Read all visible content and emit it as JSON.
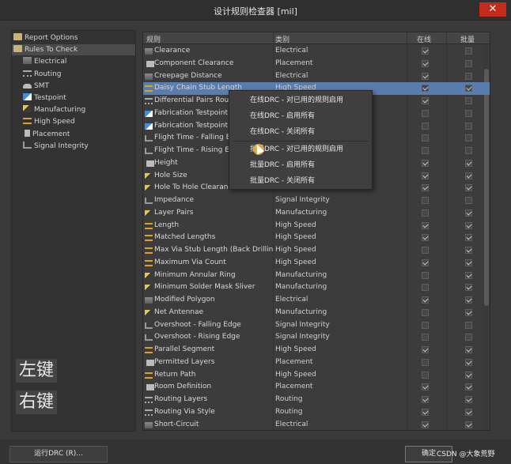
{
  "window": {
    "title": "设计规则检查器 [mil]",
    "close": "✕"
  },
  "tree": [
    {
      "label": "Report Options",
      "level": 0,
      "icon": "folder-icon",
      "selected": false
    },
    {
      "label": "Rules To Check",
      "level": 0,
      "icon": "folder-icon",
      "selected": true
    },
    {
      "label": "Electrical",
      "level": 1,
      "icon": "electrical-icon",
      "selected": false
    },
    {
      "label": "Routing",
      "level": 1,
      "icon": "routing-icon",
      "selected": false
    },
    {
      "label": "SMT",
      "level": 1,
      "icon": "smt-icon",
      "selected": false
    },
    {
      "label": "Testpoint",
      "level": 1,
      "icon": "testpoint-icon",
      "selected": false
    },
    {
      "label": "Manufacturing",
      "level": 1,
      "icon": "manufacturing-icon",
      "selected": false
    },
    {
      "label": "High Speed",
      "level": 1,
      "icon": "high-speed-icon",
      "selected": false
    },
    {
      "label": "Placement",
      "level": 1,
      "icon": "placement-icon",
      "selected": false
    },
    {
      "label": "Signal Integrity",
      "level": 1,
      "icon": "signal-integrity-icon",
      "selected": false
    }
  ],
  "hints": {
    "left": "左键",
    "right": "右键"
  },
  "table": {
    "headers": {
      "rule": "规则",
      "category": "类别",
      "online": "在线",
      "batch": "批量"
    },
    "rows": [
      {
        "rule": "Clearance",
        "category": "Electrical",
        "online": true,
        "batch": false,
        "icon": "electrical"
      },
      {
        "rule": "Component Clearance",
        "category": "Placement",
        "online": true,
        "batch": false,
        "icon": "placement"
      },
      {
        "rule": "Creepage Distance",
        "category": "Electrical",
        "online": true,
        "batch": false,
        "icon": "electrical"
      },
      {
        "rule": "Daisy Chain Stub Length",
        "category": "High Speed",
        "online": true,
        "batch": true,
        "icon": "speed"
      },
      {
        "rule": "Differential Pairs Routing",
        "category": "",
        "online": true,
        "batch": false,
        "icon": "routing"
      },
      {
        "rule": "Fabrication Testpoint S",
        "category": "",
        "online": false,
        "batch": false,
        "icon": "test"
      },
      {
        "rule": "Fabrication Testpoint U",
        "category": "",
        "online": false,
        "batch": false,
        "icon": "test"
      },
      {
        "rule": "Flight Time - Falling Ed",
        "category": "",
        "online": false,
        "batch": false,
        "icon": "signal"
      },
      {
        "rule": "Flight Time - Rising Edg",
        "category": "",
        "online": false,
        "batch": false,
        "icon": "signal"
      },
      {
        "rule": "Height",
        "category": "",
        "online": true,
        "batch": true,
        "icon": "placement"
      },
      {
        "rule": "Hole Size",
        "category": "",
        "online": true,
        "batch": true,
        "icon": "manu"
      },
      {
        "rule": "Hole To Hole Clearance",
        "category": "",
        "online": true,
        "batch": true,
        "icon": "manu"
      },
      {
        "rule": "Impedance",
        "category": "Signal Integrity",
        "online": false,
        "batch": false,
        "icon": "signal"
      },
      {
        "rule": "Layer Pairs",
        "category": "Manufacturing",
        "online": false,
        "batch": true,
        "icon": "manu"
      },
      {
        "rule": "Length",
        "category": "High Speed",
        "online": true,
        "batch": true,
        "icon": "speed"
      },
      {
        "rule": "Matched Lengths",
        "category": "High Speed",
        "online": true,
        "batch": true,
        "icon": "speed"
      },
      {
        "rule": "Max Via Stub Length (Back Drilling)",
        "category": "High Speed",
        "online": false,
        "batch": true,
        "icon": "speed"
      },
      {
        "rule": "Maximum Via Count",
        "category": "High Speed",
        "online": true,
        "batch": true,
        "icon": "speed"
      },
      {
        "rule": "Minimum Annular Ring",
        "category": "Manufacturing",
        "online": false,
        "batch": true,
        "icon": "manu"
      },
      {
        "rule": "Minimum Solder Mask Sliver",
        "category": "Manufacturing",
        "online": false,
        "batch": true,
        "icon": "manu"
      },
      {
        "rule": "Modified Polygon",
        "category": "Electrical",
        "online": true,
        "batch": true,
        "icon": "electrical"
      },
      {
        "rule": "Net Antennae",
        "category": "Manufacturing",
        "online": false,
        "batch": true,
        "icon": "manu"
      },
      {
        "rule": "Overshoot - Falling Edge",
        "category": "Signal Integrity",
        "online": false,
        "batch": false,
        "icon": "signal"
      },
      {
        "rule": "Overshoot - Rising Edge",
        "category": "Signal Integrity",
        "online": false,
        "batch": false,
        "icon": "signal"
      },
      {
        "rule": "Parallel Segment",
        "category": "High Speed",
        "online": true,
        "batch": true,
        "icon": "speed"
      },
      {
        "rule": "Permitted Layers",
        "category": "Placement",
        "online": false,
        "batch": true,
        "icon": "placement"
      },
      {
        "rule": "Return Path",
        "category": "High Speed",
        "online": false,
        "batch": true,
        "icon": "speed"
      },
      {
        "rule": "Room Definition",
        "category": "Placement",
        "online": true,
        "batch": true,
        "icon": "placement"
      },
      {
        "rule": "Routing Layers",
        "category": "Routing",
        "online": true,
        "batch": true,
        "icon": "routing"
      },
      {
        "rule": "Routing Via Style",
        "category": "Routing",
        "online": true,
        "batch": true,
        "icon": "routing"
      },
      {
        "rule": "Short-Circuit",
        "category": "Electrical",
        "online": true,
        "batch": true,
        "icon": "electrical"
      }
    ]
  },
  "context_menu": [
    "在线DRC - 对已用的规则启用",
    "在线DRC - 启用所有",
    "在线DRC - 关闭所有",
    "批量DRC - 对已用的规则启用",
    "批量DRC - 启用所有",
    "批量DRC - 关闭所有"
  ],
  "footer": {
    "run_button": "运行DRC (R)...",
    "ok_button": "确定"
  },
  "watermark": "CSDN @大象荒野"
}
